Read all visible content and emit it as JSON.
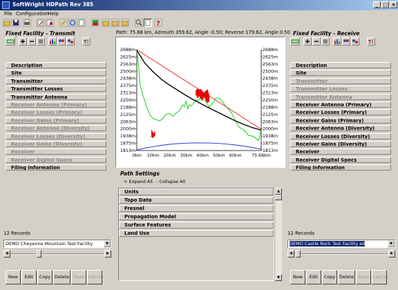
{
  "window": {
    "title": "SoftWright HDPath Rev 385",
    "buttons": [
      "_",
      "□",
      "×"
    ]
  },
  "menu": [
    "File",
    "Configuration",
    "Help"
  ],
  "toolbar_icons": [
    "open-folder-icon",
    "save-icon",
    "print-icon",
    "edit-icon",
    "export-icon",
    "pencil-icon",
    "refresh-icon",
    "document-icon",
    "map-icon",
    "folder-icon",
    "folder-icon",
    "folder-icon",
    "zoom-icon",
    "page-icon",
    "help-icon"
  ],
  "path_info": "Path: 75.68 km, Azimuth 359.62, Angle -0.50; Reverse 179.62, Angle 0.50",
  "left_panel": {
    "title": "Fixed Facility - Transmit",
    "items": [
      {
        "label": "Description",
        "enabled": true
      },
      {
        "label": "Site",
        "enabled": true
      },
      {
        "label": "Transmitter",
        "enabled": true
      },
      {
        "label": "Transmitter Losses",
        "enabled": true
      },
      {
        "label": "Transmitter Antenna",
        "enabled": true
      },
      {
        "label": "Receiver Antenna (Primary)",
        "enabled": false
      },
      {
        "label": "Receiver Losses (Primary)",
        "enabled": false
      },
      {
        "label": "Receiver Gains (Primary)",
        "enabled": false
      },
      {
        "label": "Receiver Antenna (Diversity)",
        "enabled": false
      },
      {
        "label": "Receiver Losses (Diversity)",
        "enabled": false
      },
      {
        "label": "Receiver Gains (Diversity)",
        "enabled": false
      },
      {
        "label": "Receiver",
        "enabled": false
      },
      {
        "label": "Receiver Digital Specs",
        "enabled": false
      },
      {
        "label": "Filing Information",
        "enabled": true
      }
    ],
    "records": "12 Records",
    "facility": "DEMO Cheyenne Mountain Test Facility",
    "buttons": [
      {
        "label": "New",
        "enabled": true
      },
      {
        "label": "Edit",
        "enabled": true
      },
      {
        "label": "Copy",
        "enabled": true
      },
      {
        "label": "Delete",
        "enabled": true
      },
      {
        "label": "Save",
        "enabled": false
      },
      {
        "label": "Cancel",
        "enabled": false
      }
    ]
  },
  "right_panel": {
    "title": "Fixed Facility - Receive",
    "items": [
      {
        "label": "Description",
        "enabled": true
      },
      {
        "label": "Site",
        "enabled": true
      },
      {
        "label": "Transmitter",
        "enabled": false
      },
      {
        "label": "Transmitter Losses",
        "enabled": false
      },
      {
        "label": "Transmitter Antenna",
        "enabled": false
      },
      {
        "label": "Receiver Antenna (Primary)",
        "enabled": true
      },
      {
        "label": "Receiver Losses (Primary)",
        "enabled": true
      },
      {
        "label": "Receiver Gains (Primary)",
        "enabled": true
      },
      {
        "label": "Receiver Antenna (Diversity)",
        "enabled": true
      },
      {
        "label": "Receiver Losses (Diversity)",
        "enabled": true
      },
      {
        "label": "Receiver Gains (Diversity)",
        "enabled": true
      },
      {
        "label": "Receiver",
        "enabled": true
      },
      {
        "label": "Receiver Digital Specs",
        "enabled": true
      },
      {
        "label": "Filing Information",
        "enabled": true
      }
    ],
    "records": "12 Records",
    "facility": "DEMO Castle Rock Test Facility ed",
    "buttons": [
      {
        "label": "New",
        "enabled": true
      },
      {
        "label": "Edit",
        "enabled": true
      },
      {
        "label": "Copy",
        "enabled": true
      },
      {
        "label": "Delete",
        "enabled": true
      },
      {
        "label": "Save",
        "enabled": false
      },
      {
        "label": "Cancel",
        "enabled": false
      }
    ]
  },
  "path_settings": {
    "title": "Path Settings",
    "expand_all": "+ Expand All",
    "collapse_all": "- Collapse All",
    "items": [
      "Units",
      "Topo Data",
      "Fresnel",
      "Propagation Model",
      "Surface Features",
      "Land Use"
    ]
  },
  "colors": {
    "terrain": "#00cc00",
    "earth_curve": "#2030d0",
    "los": "#e02020",
    "fresnel": "#000000",
    "obstruction": "#ee0000"
  },
  "chart_data": {
    "type": "line",
    "x_ticks": [
      "0km",
      "10km",
      "20km",
      "30km",
      "40km",
      "50km",
      "60km",
      "75.68km"
    ],
    "y_ticks": [
      "2688m",
      "2625m",
      "2563m",
      "2500m",
      "2438m",
      "2375m",
      "2313m",
      "2250m",
      "2188m",
      "2125m",
      "2063m",
      "2000m",
      "1938m",
      "1875m",
      "1813m"
    ],
    "xlim": [
      0,
      75.68
    ],
    "ylim": [
      1813,
      2688
    ],
    "series": [
      {
        "color": "#00cc00",
        "x": [
          0,
          1,
          2,
          4,
          6,
          8,
          10,
          12,
          14,
          16,
          18,
          20,
          22,
          24,
          26,
          28,
          29,
          30,
          31,
          32,
          33,
          34,
          35,
          36,
          37,
          38,
          40,
          42,
          44,
          46,
          48,
          50,
          52,
          54,
          56,
          58,
          60,
          62,
          64,
          66,
          68,
          70,
          72,
          74,
          75.68
        ],
        "y": [
          2680,
          2560,
          2380,
          2280,
          2190,
          2120,
          2090,
          2080,
          2070,
          2095,
          2130,
          2135,
          2110,
          2140,
          2160,
          2210,
          2195,
          2240,
          2175,
          2210,
          2200,
          2215,
          2235,
          2255,
          2245,
          2262,
          2260,
          2240,
          2190,
          2220,
          2265,
          2270,
          2240,
          2200,
          2170,
          2130,
          2070,
          2020,
          2000,
          1980,
          1945,
          1940,
          1925,
          1900,
          1990
        ]
      },
      {
        "color": "#000000",
        "x": [
          0,
          5,
          10,
          15,
          20,
          25,
          30,
          35,
          40,
          45,
          50,
          55,
          60,
          65,
          70,
          75.68
        ],
        "y": [
          2680,
          2570,
          2495,
          2430,
          2380,
          2335,
          2290,
          2250,
          2212,
          2175,
          2140,
          2105,
          2070,
          2040,
          2013,
          1990
        ]
      },
      {
        "color": "#e02020",
        "x": [
          0,
          75.68
        ],
        "y": [
          2688,
          1998
        ]
      },
      {
        "color": "#2030d0",
        "x": [
          0,
          5,
          10,
          15,
          20,
          25,
          30,
          35,
          40,
          45,
          50,
          55,
          60,
          65,
          70,
          75.68
        ],
        "y": [
          1818,
          1834,
          1847,
          1858,
          1867,
          1873,
          1877,
          1879,
          1879,
          1878,
          1875,
          1869,
          1861,
          1852,
          1840,
          1825
        ]
      }
    ],
    "obstructions": [
      {
        "x": [
          36,
          37,
          38,
          39,
          40,
          41,
          42,
          43,
          44
        ],
        "y_top": [
          2330,
          2350,
          2335,
          2345,
          2320,
          2310,
          2330,
          2340,
          2290
        ],
        "y_bot": [
          2300,
          2270,
          2290,
          2260,
          2250,
          2285,
          2250,
          2230,
          2240
        ]
      },
      {
        "x": [
          9,
          10,
          11
        ],
        "y_top": [
          1990,
          1960,
          1975
        ],
        "y_bot": [
          1930,
          1925,
          1945
        ]
      }
    ]
  }
}
